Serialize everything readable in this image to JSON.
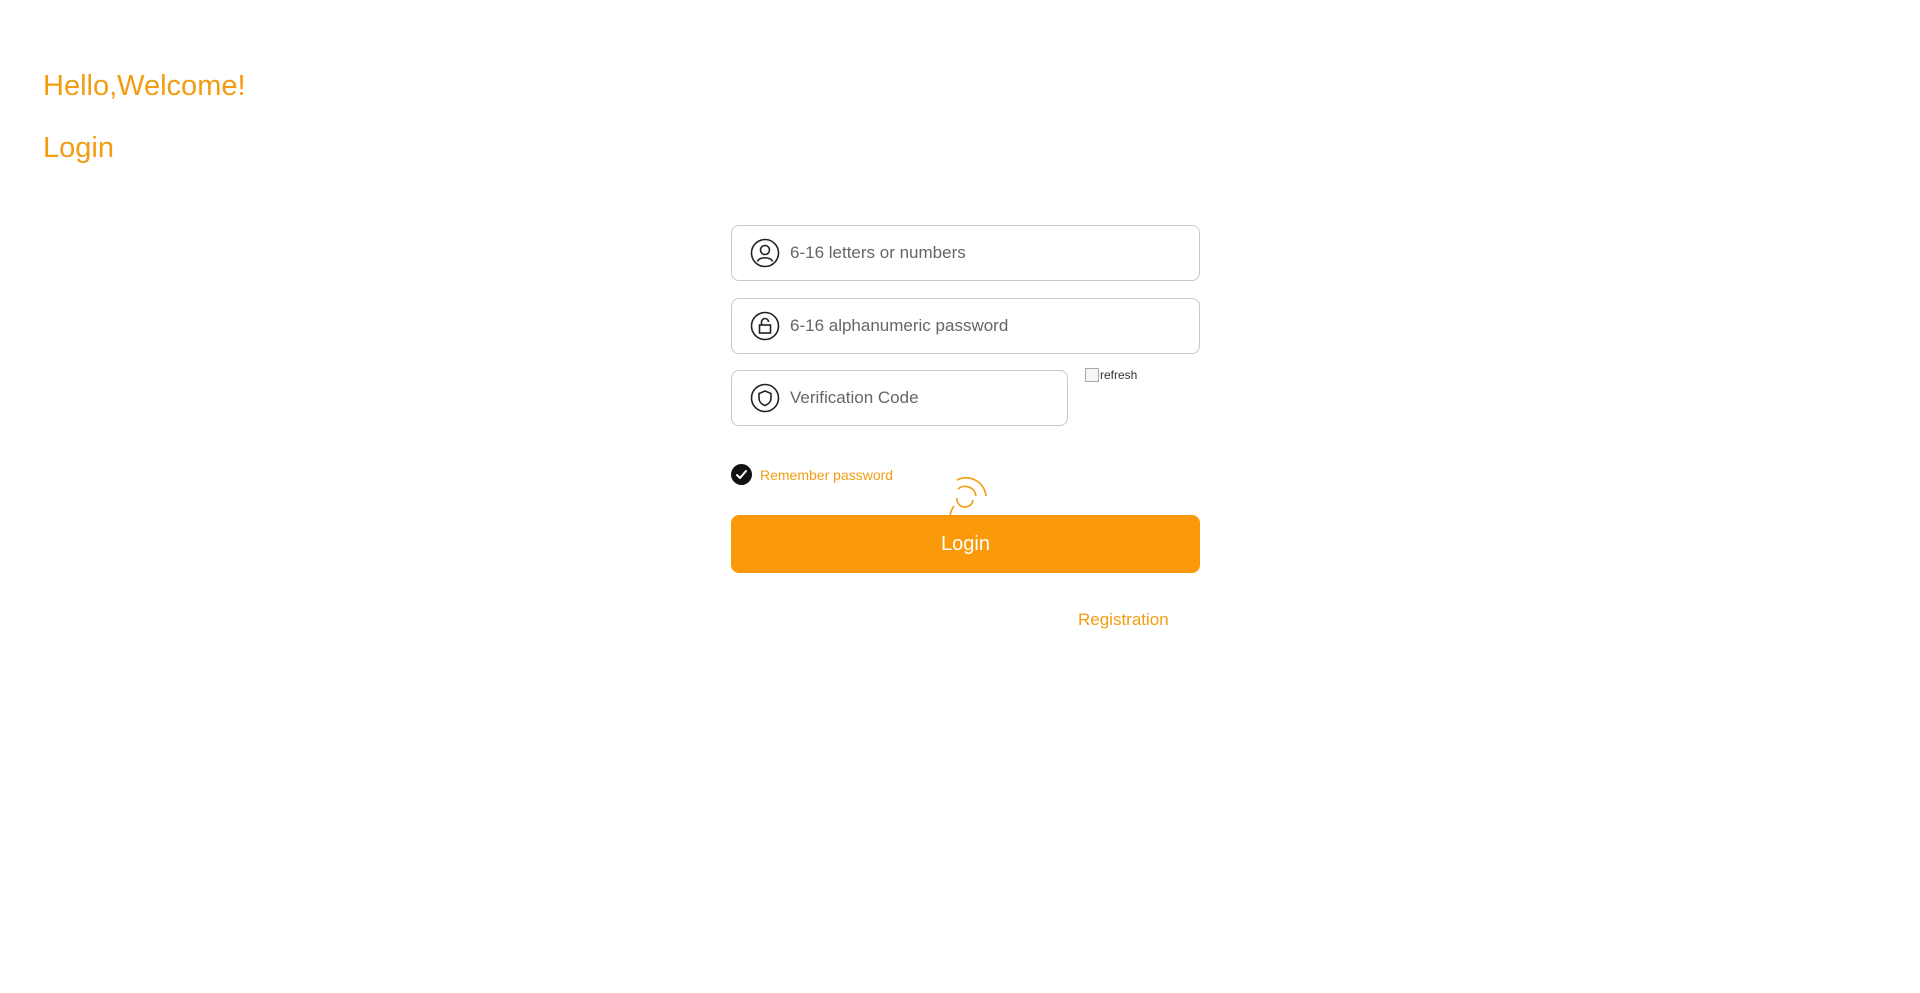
{
  "header": {
    "greeting": "Hello,Welcome!",
    "title": "Login"
  },
  "form": {
    "username": {
      "placeholder": "6-16 letters or numbers",
      "value": "",
      "icon": "user-icon"
    },
    "password": {
      "placeholder": "6-16 alphanumeric password",
      "value": "",
      "icon": "lock-icon"
    },
    "captcha": {
      "placeholder": "Verification Code",
      "value": "",
      "icon": "shield-icon",
      "image_alt": "refresh"
    },
    "remember": {
      "label": "Remember password",
      "checked": true
    },
    "login_button": "Login",
    "register_link": "Registration"
  },
  "colors": {
    "accent": "#f39c12",
    "button": "#fa9a0a",
    "check": "#111111"
  }
}
